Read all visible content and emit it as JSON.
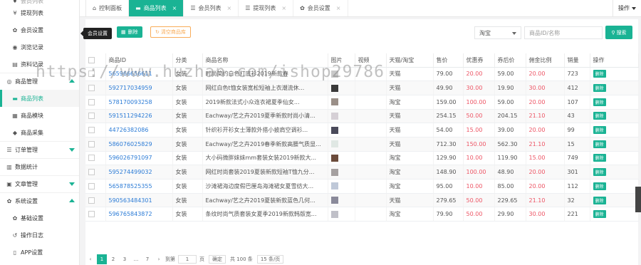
{
  "sidebar": {
    "items": [
      {
        "label": "会员列表",
        "icon": "user-icon",
        "glyph": "♦",
        "kind": "partial"
      },
      {
        "label": "提现列表",
        "icon": "yen-icon",
        "glyph": "¥",
        "kind": "sub"
      },
      {
        "label": "会员设置",
        "icon": "gear-icon",
        "glyph": "✿",
        "kind": "sub"
      },
      {
        "label": "浏览记录",
        "icon": "eye-icon",
        "glyph": "◉",
        "kind": "sub"
      },
      {
        "label": "资料记录",
        "icon": "id-card-icon",
        "glyph": "▤",
        "kind": "sub"
      },
      {
        "label": "商品管理",
        "icon": "box-icon",
        "glyph": "◎",
        "kind": "section",
        "caret": "up"
      },
      {
        "label": "商品列表",
        "icon": "list-icon",
        "glyph": "▬",
        "kind": "active"
      },
      {
        "label": "商品模块",
        "icon": "grid-icon",
        "glyph": "▦",
        "kind": "sub"
      },
      {
        "label": "商品采集",
        "icon": "cube-icon",
        "glyph": "◆",
        "kind": "sub"
      },
      {
        "label": "订单管理",
        "icon": "order-icon",
        "glyph": "☰",
        "kind": "section",
        "caret": "down"
      },
      {
        "label": "数据统计",
        "icon": "chart-icon",
        "glyph": "▥",
        "kind": "section"
      },
      {
        "label": "文章管理",
        "icon": "article-icon",
        "glyph": "▣",
        "kind": "section",
        "caret": "down"
      },
      {
        "label": "系统设置",
        "icon": "settings-icon",
        "glyph": "✿",
        "kind": "section",
        "caret": "up"
      },
      {
        "label": "基础设置",
        "icon": "cogs-icon",
        "glyph": "✿",
        "kind": "sub"
      },
      {
        "label": "操作日志",
        "icon": "history-icon",
        "glyph": "↺",
        "kind": "sub"
      },
      {
        "label": "APP设置",
        "icon": "mobile-icon",
        "glyph": "▯",
        "kind": "sub"
      }
    ]
  },
  "tooltip": "会员设置",
  "tabs": [
    {
      "label": "控制面板",
      "icon": "home-icon",
      "glyph": "⌂",
      "active": false,
      "closable": false
    },
    {
      "label": "商品列表",
      "icon": "list-icon",
      "glyph": "▬",
      "active": true,
      "closable": true
    },
    {
      "label": "会员列表",
      "icon": "list-icon",
      "glyph": "☰",
      "active": false,
      "closable": true
    },
    {
      "label": "提现列表",
      "icon": "list-icon",
      "glyph": "☰",
      "active": false,
      "closable": true
    },
    {
      "label": "会员设置",
      "icon": "gear-icon",
      "glyph": "✿",
      "active": false,
      "closable": true
    }
  ],
  "tab_close": "×",
  "ops_label": "操作",
  "toolbar": {
    "delete_label": "删除",
    "clear_label": "清空商品库",
    "source_select": "淘宝",
    "search_placeholder": "商品ID/名称",
    "search_label": "搜索"
  },
  "table": {
    "columns": [
      "",
      "商品ID",
      "分类",
      "商品名称",
      "图片",
      "视频",
      "天猫/淘宝",
      "售价",
      "优惠券",
      "券后价",
      "佣金比例",
      "销量",
      "操作"
    ],
    "rows": [
      {
        "id": "565966656611",
        "cat": "女装",
        "name": "时尚简约白色打底衫2019新款春",
        "platform": "天猫",
        "price": "79.00",
        "coupon": "20.00",
        "after": "59.00",
        "rate": "20.00",
        "sales": "723"
      },
      {
        "id": "592717034959",
        "cat": "女装",
        "name": "网红白色t恤女装宽松短袖上衣潮流休...",
        "platform": "天猫",
        "price": "49.90",
        "coupon": "30.00",
        "after": "19.90",
        "rate": "30.00",
        "sales": "412"
      },
      {
        "id": "578170093258",
        "cat": "女装",
        "name": "2019新款法式小众连衣裙夏季仙女...",
        "platform": "淘宝",
        "price": "159.00",
        "coupon": "100.00",
        "after": "59.00",
        "rate": "20.00",
        "sales": "107"
      },
      {
        "id": "591511294226",
        "cat": "女装",
        "name": "Eachway/艺之卉2019夏季新款时尚小清...",
        "platform": "天猫",
        "price": "254.15",
        "coupon": "50.00",
        "after": "204.15",
        "rate": "21.10",
        "sales": "43"
      },
      {
        "id": "44726382086",
        "cat": "女装",
        "name": "针织衫开衫女士薄款外搭小披肩空调衫...",
        "platform": "天猫",
        "price": "54.00",
        "coupon": "15.00",
        "after": "39.00",
        "rate": "20.00",
        "sales": "99"
      },
      {
        "id": "586076025829",
        "cat": "女装",
        "name": "Eachway/艺之卉2019春季新款高腰气质显...",
        "platform": "天猫",
        "price": "712.30",
        "coupon": "150.00",
        "after": "562.30",
        "rate": "21.10",
        "sales": "15"
      },
      {
        "id": "596026791097",
        "cat": "女装",
        "name": "大小码微胖妹妹mm套装女装2019新款大...",
        "platform": "淘宝",
        "price": "129.90",
        "coupon": "10.00",
        "after": "119.90",
        "rate": "15.00",
        "sales": "749"
      },
      {
        "id": "595274499032",
        "cat": "女装",
        "name": "网红时尚套装2019夏装新款短袖T恤九分...",
        "platform": "淘宝",
        "price": "148.90",
        "coupon": "100.00",
        "after": "48.90",
        "rate": "20.00",
        "sales": "301"
      },
      {
        "id": "565878525355",
        "cat": "女装",
        "name": "沙滩裙海边度假巴厘岛海滩裙女夏雪纺大...",
        "platform": "淘宝",
        "price": "95.00",
        "coupon": "10.00",
        "after": "85.00",
        "rate": "20.00",
        "sales": "112"
      },
      {
        "id": "590563484301",
        "cat": "女装",
        "name": "Eachway/艺之卉2019夏装新款蓝色几何...",
        "platform": "天猫",
        "price": "279.65",
        "coupon": "50.00",
        "after": "229.65",
        "rate": "21.10",
        "sales": "32"
      },
      {
        "id": "596765843872",
        "cat": "女装",
        "name": "条纹时尚气质套装女夏季2019新款韩版宽...",
        "platform": "淘宝",
        "price": "79.90",
        "coupon": "50.00",
        "after": "29.90",
        "rate": "30.00",
        "sales": "221"
      }
    ],
    "row_action": "删除"
  },
  "pager": {
    "prev": "‹",
    "pages": [
      "1",
      "2",
      "3",
      "...",
      "7"
    ],
    "next": "›",
    "goto_label": "到第",
    "goto_value": "1",
    "page_unit": "页",
    "confirm": "确定",
    "total": "共 100 条",
    "page_size": "15 条/页"
  },
  "watermark": "https://www.huzhan.com/ishop29786",
  "colors": {
    "accent": "#1ab394",
    "danger": "#ed5565",
    "warning": "#f8ac59",
    "link": "#2b7bd6"
  }
}
